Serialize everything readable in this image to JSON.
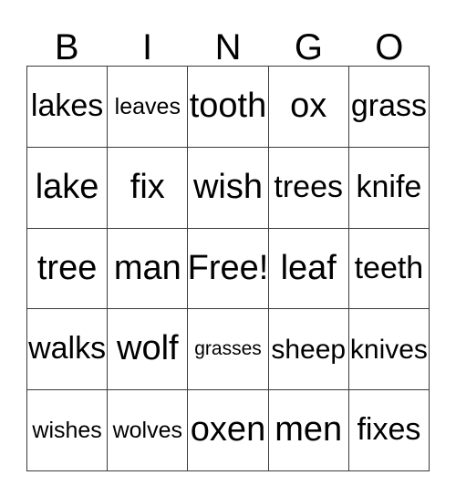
{
  "card": {
    "header": {
      "letters": [
        "B",
        "I",
        "N",
        "G",
        "O"
      ]
    },
    "rows": [
      [
        {
          "text": "lakes",
          "size": "lg"
        },
        {
          "text": "leaves",
          "size": "sm"
        },
        {
          "text": "tooth",
          "size": "xl"
        },
        {
          "text": "ox",
          "size": "xl"
        },
        {
          "text": "grass",
          "size": "lg"
        }
      ],
      [
        {
          "text": "lake",
          "size": "xl"
        },
        {
          "text": "fix",
          "size": "xl"
        },
        {
          "text": "wish",
          "size": "xl"
        },
        {
          "text": "trees",
          "size": "lg"
        },
        {
          "text": "knife",
          "size": "lg"
        }
      ],
      [
        {
          "text": "tree",
          "size": "xl"
        },
        {
          "text": "man",
          "size": "xl"
        },
        {
          "text": "Free!",
          "size": "xl"
        },
        {
          "text": "leaf",
          "size": "xl"
        },
        {
          "text": "teeth",
          "size": "lg"
        }
      ],
      [
        {
          "text": "walks",
          "size": "lg"
        },
        {
          "text": "wolf",
          "size": "xl"
        },
        {
          "text": "grasses",
          "size": "xs"
        },
        {
          "text": "sheep",
          "size": "md"
        },
        {
          "text": "knives",
          "size": "md"
        }
      ],
      [
        {
          "text": "wishes",
          "size": "sm"
        },
        {
          "text": "wolves",
          "size": "sm"
        },
        {
          "text": "oxen",
          "size": "xl"
        },
        {
          "text": "men",
          "size": "xl"
        },
        {
          "text": "fixes",
          "size": "lg"
        }
      ]
    ],
    "colors": {
      "border": "#3a3a3a",
      "text": "#000000",
      "background": "#ffffff"
    }
  }
}
